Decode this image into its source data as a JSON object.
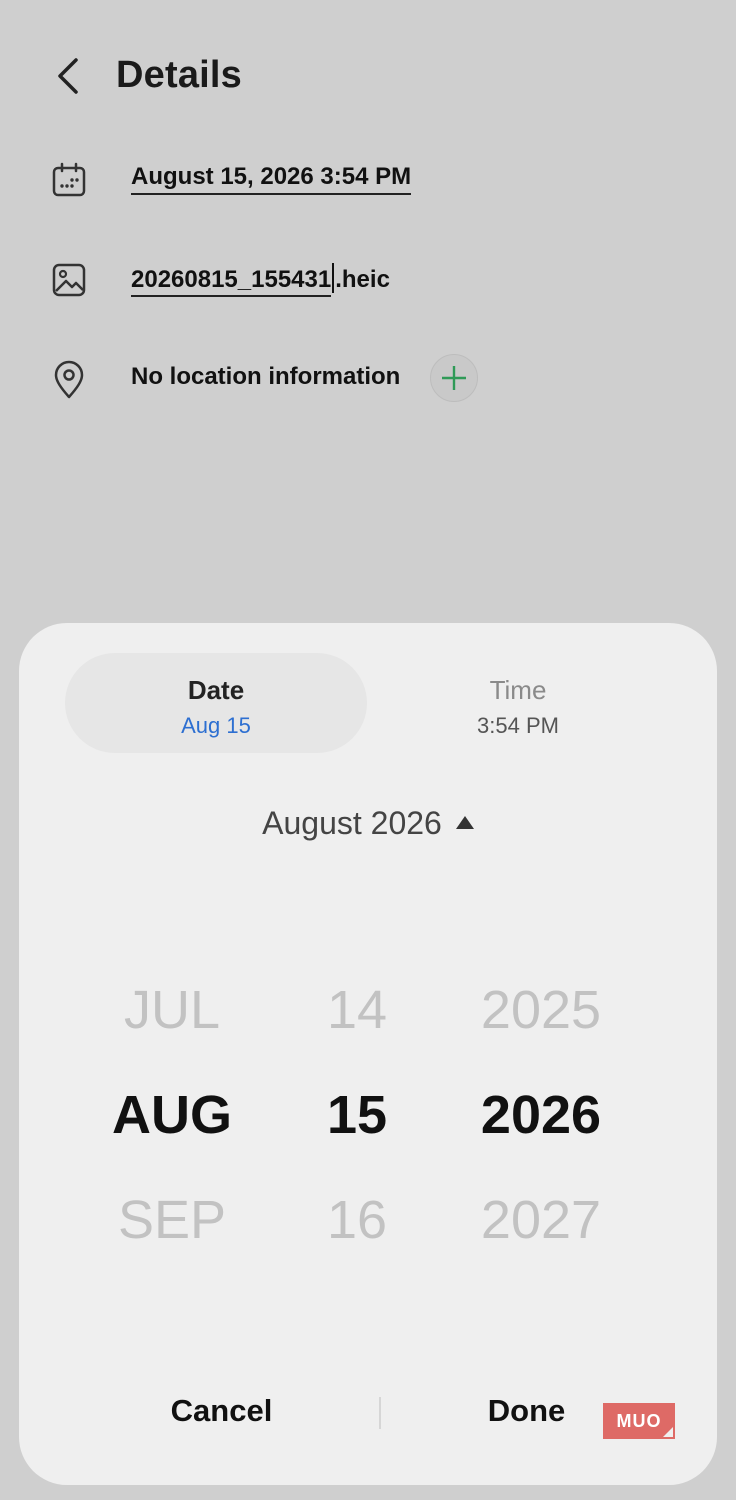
{
  "header": {
    "title": "Details"
  },
  "details": {
    "datetime": "August 15, 2026 3:54 PM",
    "filename_base": "20260815_155431",
    "filename_ext": ".heic",
    "location": "No location information"
  },
  "dialog": {
    "tabs": {
      "date": {
        "label": "Date",
        "value": "Aug 15"
      },
      "time": {
        "label": "Time",
        "value": "3:54 PM"
      }
    },
    "month_toggle": "August 2026",
    "picker": {
      "month": {
        "prev": "JUL",
        "selected": "AUG",
        "next": "SEP"
      },
      "day": {
        "prev": "14",
        "selected": "15",
        "next": "16"
      },
      "year": {
        "prev": "2025",
        "selected": "2026",
        "next": "2027"
      }
    },
    "cancel_label": "Cancel",
    "done_label": "Done"
  },
  "watermark": "MUO",
  "colors": {
    "accent": "#2d6fd1",
    "add_icon": "#2f9a57",
    "watermark_bg": "#de6a66"
  }
}
